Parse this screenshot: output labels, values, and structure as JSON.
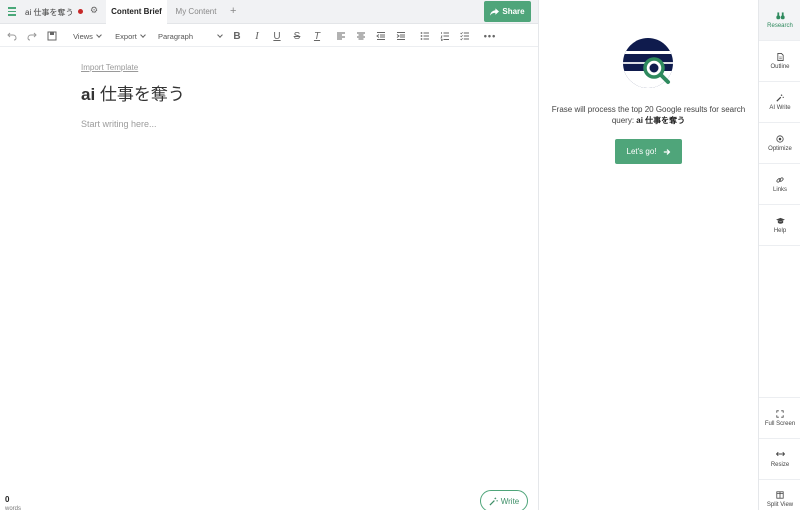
{
  "topbar": {
    "document_name": "ai 仕事を奪う",
    "tabs": [
      {
        "label": "Content Brief",
        "active": true
      },
      {
        "label": "My Content",
        "active": false
      }
    ],
    "add_tab_symbol": "+",
    "share_label": "Share"
  },
  "toolbar": {
    "views_label": "Views",
    "export_label": "Export",
    "paragraph_label": "Paragraph"
  },
  "editor": {
    "import_template_label": "Import Template",
    "title_bold": "ai",
    "title_rest": " 仕事を奪う",
    "placeholder": "Start writing here...",
    "word_count": "0",
    "word_count_label": "words",
    "write_label": "Write"
  },
  "research": {
    "message": "Frase will process the top 20 Google results for search query:",
    "query": "ai 仕事を奪う",
    "cta_label": "Let's go!"
  },
  "sidenav": {
    "items": [
      {
        "label": "Research",
        "icon": "binoculars-icon",
        "active": true
      },
      {
        "label": "Outline",
        "icon": "document-icon"
      },
      {
        "label": "AI Write",
        "icon": "magic-wand-icon"
      },
      {
        "label": "Optimize",
        "icon": "target-icon"
      },
      {
        "label": "Links",
        "icon": "link-icon"
      },
      {
        "label": "Help",
        "icon": "graduation-cap-icon"
      }
    ],
    "bottom_items": [
      {
        "label": "Full Screen",
        "icon": "expand-icon"
      },
      {
        "label": "Resize",
        "icon": "resize-arrows-icon"
      },
      {
        "label": "Split View",
        "icon": "split-view-icon"
      }
    ]
  },
  "colors": {
    "accent_green": "#4fa57a",
    "status_red": "#c62828",
    "logo_navy": "#0f1b4d"
  }
}
